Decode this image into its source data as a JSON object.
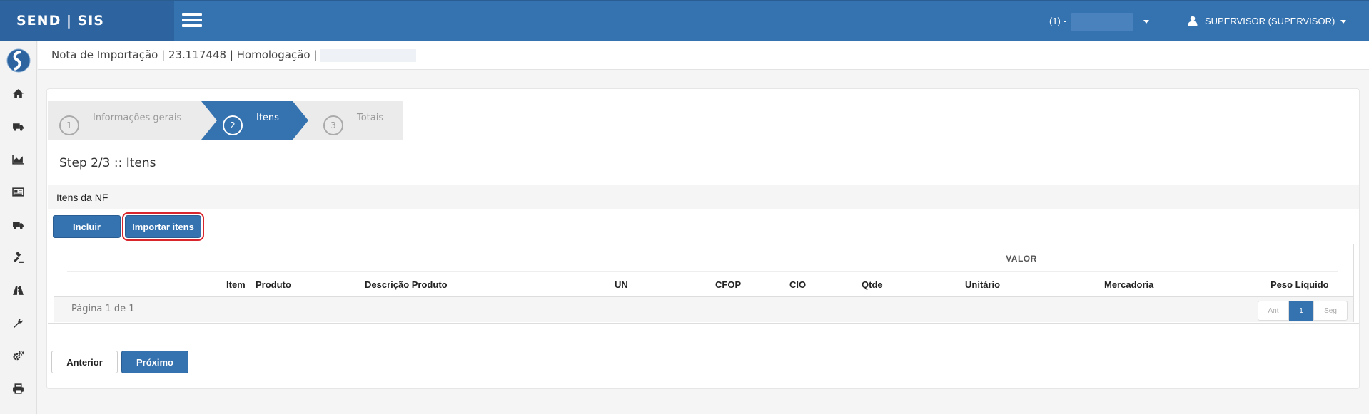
{
  "app": {
    "brand": "SEND | SIS"
  },
  "topbar": {
    "company_label": "(1) -",
    "user_label": "SUPERVISOR (SUPERVISOR)"
  },
  "sidebar": {
    "items": [
      {
        "icon": "home-icon"
      },
      {
        "icon": "truck-icon"
      },
      {
        "icon": "area-chart-icon"
      },
      {
        "icon": "newspaper-icon"
      },
      {
        "icon": "truck-icon"
      },
      {
        "icon": "gavel-icon"
      },
      {
        "icon": "road-icon"
      },
      {
        "icon": "wrench-icon"
      },
      {
        "icon": "gears-icon"
      },
      {
        "icon": "print-icon"
      }
    ]
  },
  "page": {
    "title": "Nota de Importação | 23.117448 | Homologação |"
  },
  "wizard": {
    "steps": [
      {
        "num": "1",
        "label": "Informações gerais"
      },
      {
        "num": "2",
        "label": "Itens"
      },
      {
        "num": "3",
        "label": "Totais"
      }
    ],
    "active": 1,
    "heading": "Step 2/3 :: Itens"
  },
  "panel": {
    "title": "Itens da NF",
    "buttons": {
      "incluir": "Incluir",
      "importar": "Importar itens"
    }
  },
  "table": {
    "group_header": "VALOR",
    "columns": [
      "Item",
      "Produto",
      "Descrição Produto",
      "UN",
      "CFOP",
      "CIO",
      "Qtde",
      "Unitário",
      "Mercadoria",
      "Peso Líquido"
    ],
    "rows": []
  },
  "pagination": {
    "info": "Página 1 de 1",
    "prev": "Ant",
    "current": "1",
    "next": "Seg"
  },
  "footer": {
    "anterior": "Anterior",
    "proximo": "Próximo"
  },
  "colors": {
    "primary": "#3572b0",
    "brand_bg": "#2d64a0",
    "highlight": "#d9262c"
  }
}
